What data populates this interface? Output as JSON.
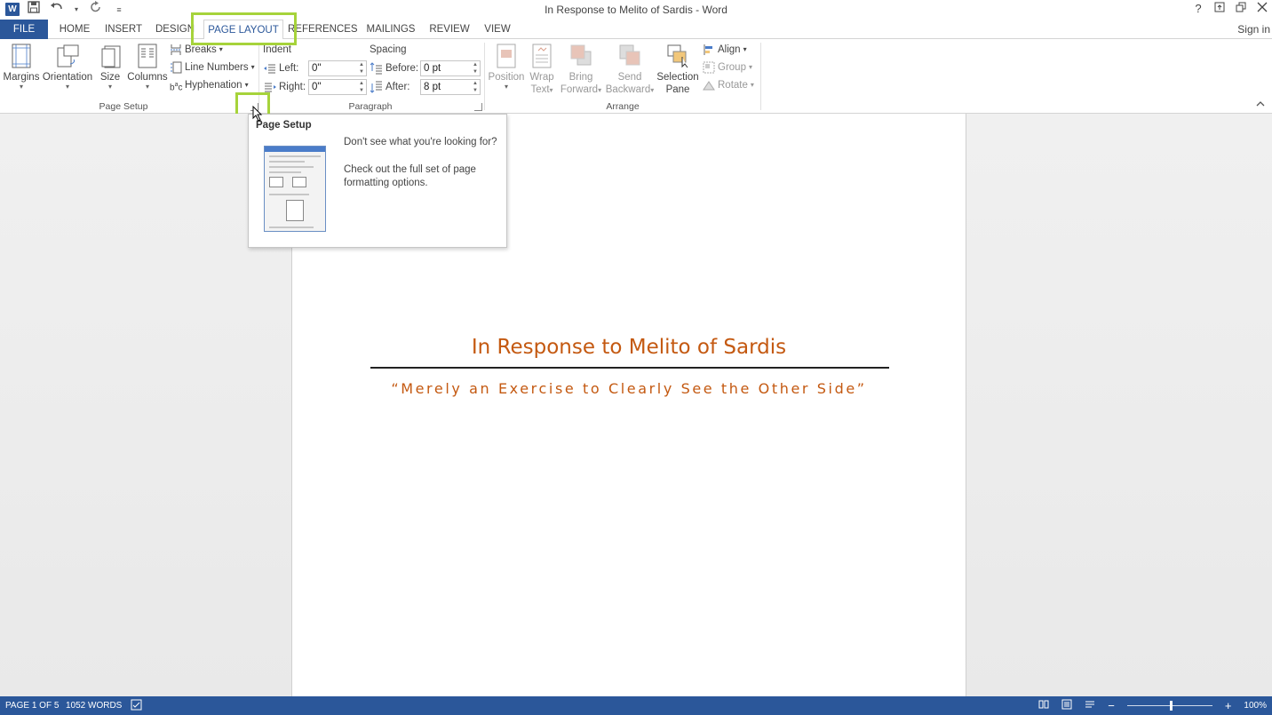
{
  "app": {
    "title": "In Response to Melito of Sardis - Word",
    "logo_letter": "W",
    "qat_icons": [
      "save-icon",
      "undo-icon",
      "redo-icon",
      "customize-icon"
    ],
    "window_controls": [
      "?",
      "⧉",
      "🗗",
      "✕"
    ],
    "sign_in": "Sign in"
  },
  "tabs": [
    {
      "label": "FILE"
    },
    {
      "label": "HOME"
    },
    {
      "label": "INSERT"
    },
    {
      "label": "DESIGN"
    },
    {
      "label": "PAGE LAYOUT"
    },
    {
      "label": "REFERENCES"
    },
    {
      "label": "MAILINGS"
    },
    {
      "label": "REVIEW"
    },
    {
      "label": "VIEW"
    }
  ],
  "ribbon": {
    "page_setup": {
      "label": "Page Setup",
      "margins": "Margins",
      "orientation": "Orientation",
      "size": "Size",
      "columns": "Columns",
      "breaks": "Breaks",
      "line_numbers": "Line Numbers",
      "hyphenation": "Hyphenation"
    },
    "paragraph": {
      "label": "Paragraph",
      "indent_title": "Indent",
      "spacing_title": "Spacing",
      "left_label": "Left:",
      "right_label": "Right:",
      "left_value": "0\"",
      "right_value": "0\"",
      "before_label": "Before:",
      "after_label": "After:",
      "before_value": "0 pt",
      "after_value": "8 pt"
    },
    "arrange": {
      "label": "Arrange",
      "position_1": "Position",
      "wrap_1": "Wrap",
      "wrap_2": "Text",
      "bring_1": "Bring",
      "bring_2": "Forward",
      "send_1": "Send",
      "send_2": "Backward",
      "selection_1": "Selection",
      "selection_2": "Pane",
      "align": "Align",
      "group": "Group",
      "rotate": "Rotate"
    }
  },
  "tooltip": {
    "title": "Page Setup",
    "line1": "Don't see what you're looking for?",
    "line2": "Check out the full set of page formatting options."
  },
  "document": {
    "heading": "In Response to Melito of Sardis",
    "subheading": "“Merely an Exercise to Clearly See the Other Side”"
  },
  "status": {
    "page": "PAGE 1 OF 5",
    "words": "1052 WORDS",
    "zoom": "100%",
    "zoom_level_percent": 100
  },
  "colors": {
    "brand": "#2b579a",
    "highlight": "#a6d33b",
    "heading": "#c45911"
  }
}
